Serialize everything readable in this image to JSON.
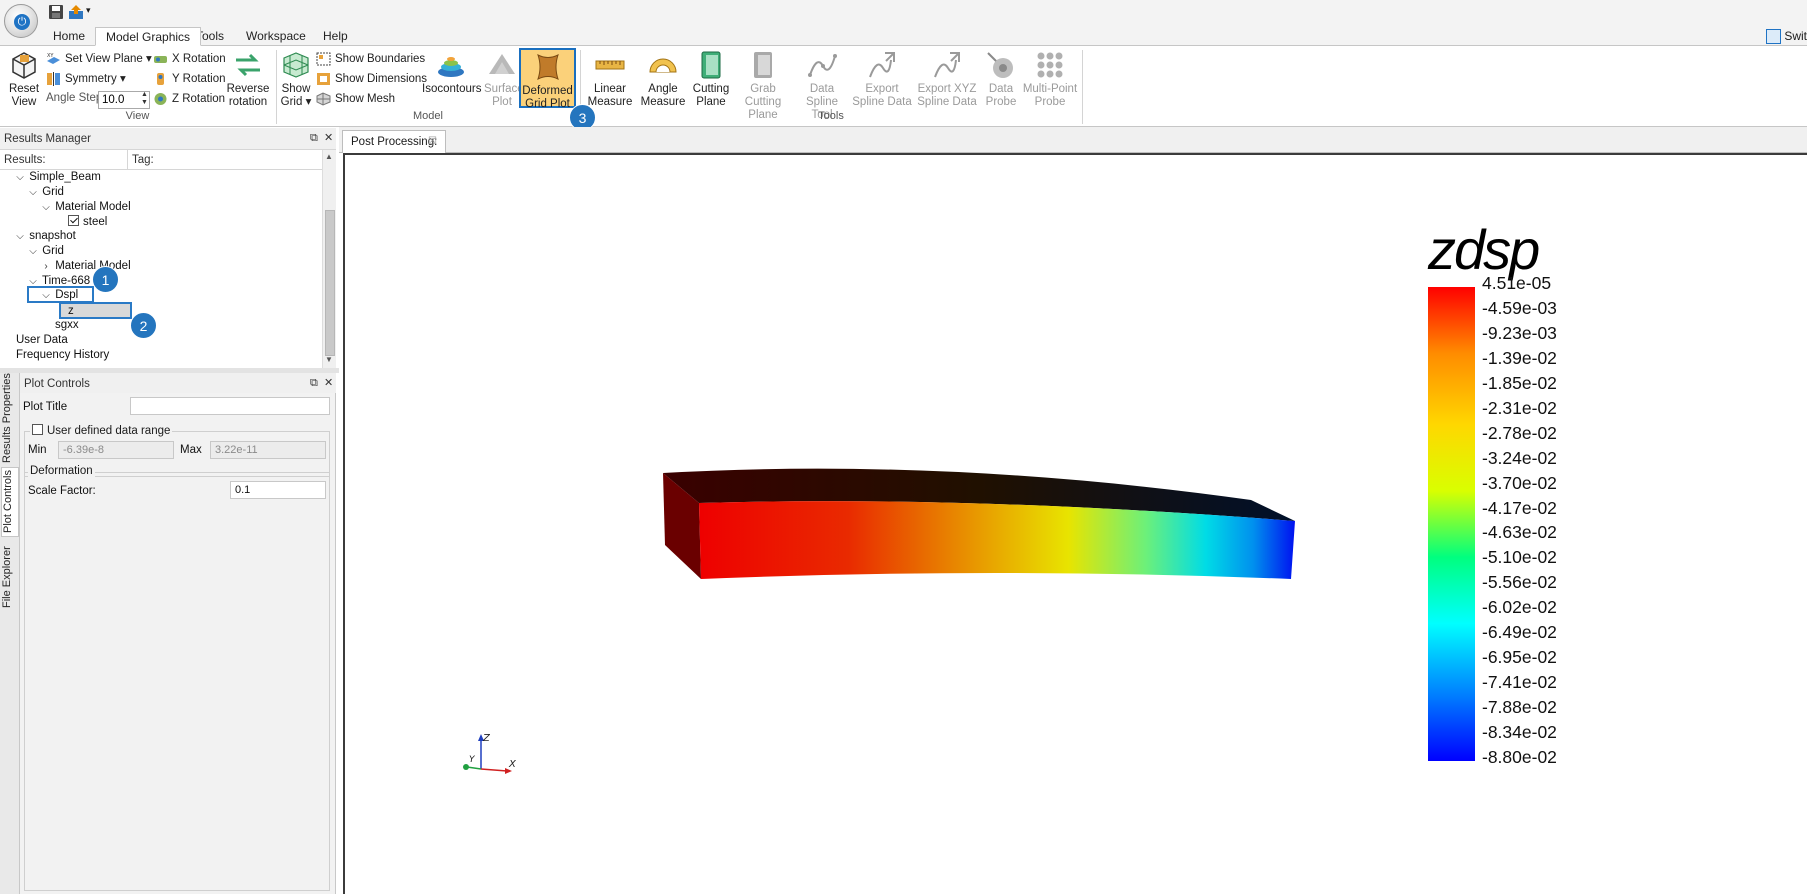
{
  "tabs": [
    {
      "label": "Home"
    },
    {
      "label": "Model Graphics",
      "active": true
    },
    {
      "label": "Tools"
    },
    {
      "label": "Workspace"
    },
    {
      "label": "Help"
    }
  ],
  "switch_label": "Swit",
  "view_group": {
    "label": "View",
    "reset_view": "Reset View",
    "set_view_plane": "Set View Plane",
    "symmetry": "Symmetry",
    "angle_step_label": "Angle Step:",
    "angle_step_value": "10.0",
    "x_rotation": "X Rotation",
    "y_rotation": "Y Rotation",
    "z_rotation": "Z Rotation",
    "reverse_rotation": "Reverse rotation"
  },
  "model_group": {
    "label": "Model",
    "show_grid": "Show Grid",
    "show_boundaries": "Show Boundaries",
    "show_dimensions": "Show Dimensions",
    "show_mesh": "Show Mesh",
    "isocontours": "Isocontours",
    "surface_plot": "Surface Plot",
    "deformed_grid_plot": "Deformed Grid Plot"
  },
  "tools_group": {
    "label": "Tools",
    "linear_measure": "Linear Measure",
    "angle_measure": "Angle Measure",
    "cutting_plane": "Cutting Plane",
    "grab_cutting_plane": "Grab Cutting Plane",
    "data_spline_tool": "Data Spline Tool",
    "export_spline_data": "Export Spline Data",
    "export_xyz_spline_data": "Export XYZ Spline Data",
    "data_probe": "Data Probe",
    "multi_point_probe": "Multi-Point Probe"
  },
  "callouts": [
    "1",
    "2",
    "3"
  ],
  "results_manager": {
    "title": "Results Manager",
    "col_results": "Results:",
    "col_tag": "Tag:",
    "tree": [
      {
        "label": "Simple_Beam",
        "chev": "⌵"
      },
      {
        "label": "Grid",
        "chev": "⌵"
      },
      {
        "label": "Material Model",
        "chev": "⌵"
      },
      {
        "label": "steel",
        "checkbox": true
      },
      {
        "label": "snapshot",
        "chev": "⌵"
      },
      {
        "label": "Grid",
        "chev": "⌵"
      },
      {
        "label": "Material Model",
        "chev": "›"
      },
      {
        "label": "Time-668",
        "chev": "⌵"
      },
      {
        "label": "Dspl",
        "chev": "⌵"
      },
      {
        "label": "z"
      },
      {
        "label": "sgxx"
      },
      {
        "label": "User Data"
      },
      {
        "label": "Frequency History"
      }
    ]
  },
  "plot_controls": {
    "title": "Plot Controls",
    "plot_title_label": "Plot Title",
    "plot_title_value": "",
    "user_defined_range": "User defined data range",
    "min_label": "Min",
    "min_value": "-6.39e-8",
    "max_label": "Max",
    "max_value": "3.22e-11",
    "deformation_label": "Deformation",
    "scale_factor_label": "Scale Factor:",
    "scale_factor_value": "0.1"
  },
  "side_tabs": [
    "Results Properties",
    "Plot Controls",
    "File Explorer"
  ],
  "document_tab": "Post Processing:",
  "scale_bar": {
    "title": "zdsp",
    "labels": [
      "4.51e-05",
      "-4.59e-03",
      "-9.23e-03",
      "-1.39e-02",
      "-1.85e-02",
      "-2.31e-02",
      "-2.78e-02",
      "-3.24e-02",
      "-3.70e-02",
      "-4.17e-02",
      "-4.63e-02",
      "-5.10e-02",
      "-5.56e-02",
      "-6.02e-02",
      "-6.49e-02",
      "-6.95e-02",
      "-7.41e-02",
      "-7.88e-02",
      "-8.34e-02",
      "-8.80e-02"
    ],
    "colors": [
      "#ff0000",
      "#ff8c00",
      "#ffd700",
      "#d9ff00",
      "#00ff7f",
      "#00ffff",
      "#007fff",
      "#0000ff"
    ]
  },
  "triad": {
    "x": "X",
    "y": "Y",
    "z": "Z"
  }
}
